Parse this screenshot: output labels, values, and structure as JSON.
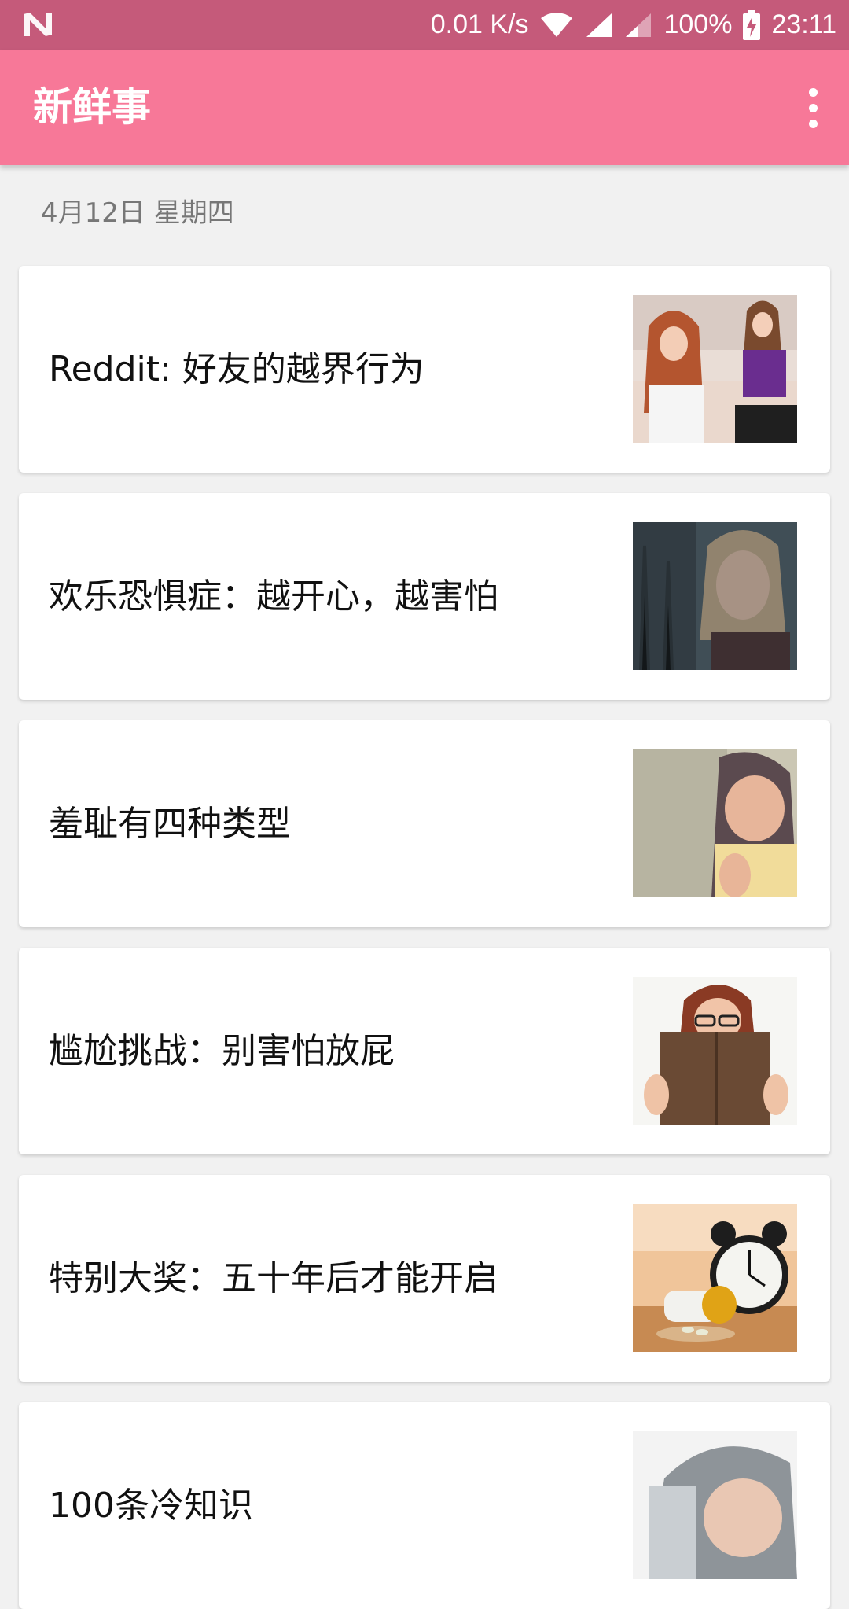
{
  "status_bar": {
    "network_speed": "0.01 K/s",
    "battery": "100%",
    "time": "23:11",
    "icons": [
      "notification-n-icon",
      "wifi-icon",
      "signal-icon",
      "signal-icon",
      "battery-charging-icon"
    ]
  },
  "app_bar": {
    "title": "新鲜事",
    "menu_icon": "overflow-menu-icon"
  },
  "feed": {
    "date_header": "4月12日 星期四",
    "items": [
      {
        "title": "Reddit: 好友的越界行为"
      },
      {
        "title": "欢乐恐惧症：越开心，越害怕"
      },
      {
        "title": "羞耻有四种类型"
      },
      {
        "title": "尴尬挑战：别害怕放屁"
      },
      {
        "title": "特别大奖：五十年后才能开启"
      },
      {
        "title": "100条冷知识"
      }
    ]
  },
  "colors": {
    "status_bar": "#c55a7a",
    "app_bar": "#f77898",
    "background": "#f1f1f1",
    "card": "#ffffff"
  }
}
